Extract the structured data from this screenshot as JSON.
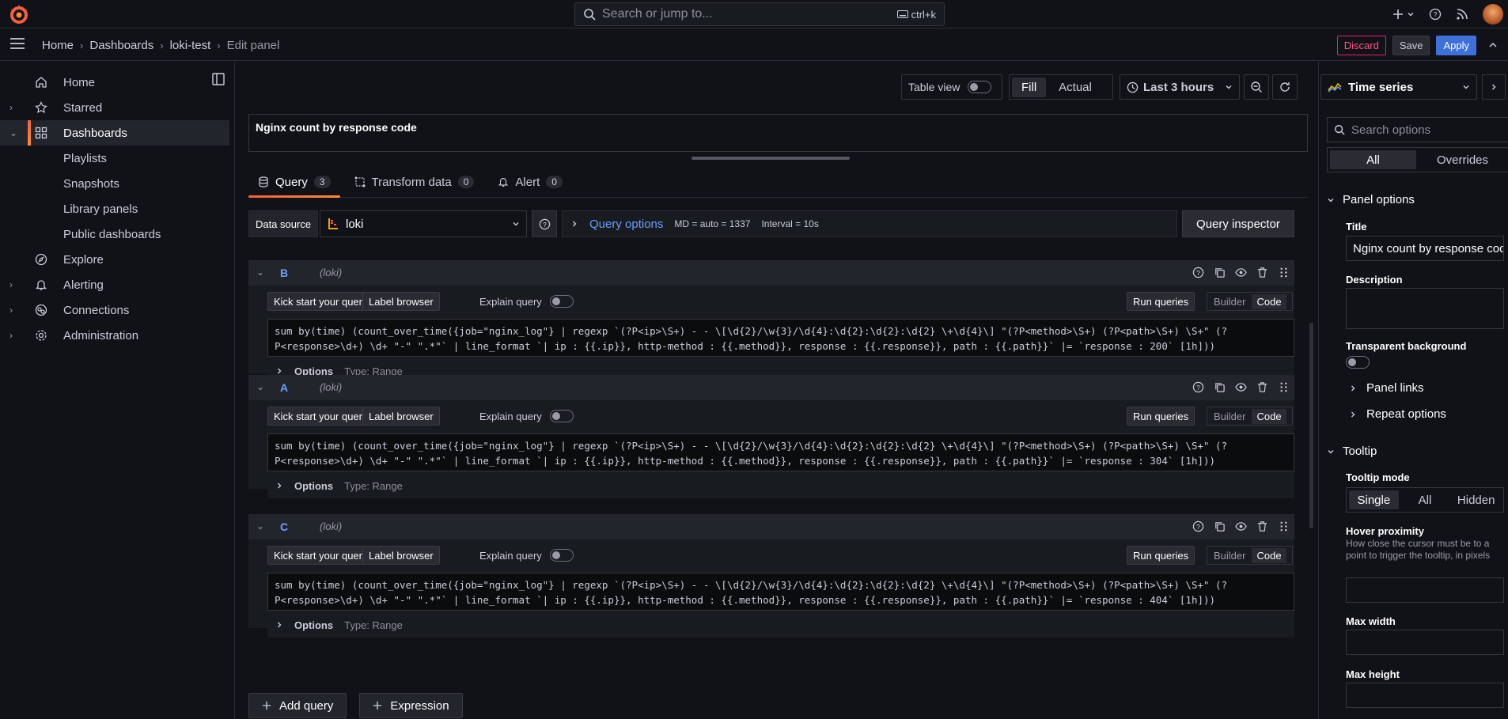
{
  "topbar": {
    "search_placeholder": "Search or jump to...",
    "shortcut": "ctrl+k"
  },
  "breadcrumb": {
    "items": [
      "Home",
      "Dashboards",
      "loki-test",
      "Edit panel"
    ]
  },
  "actions": {
    "discard": "Discard",
    "save": "Save",
    "apply": "Apply"
  },
  "sidebar": {
    "items": [
      {
        "label": "Home",
        "icon": "home-icon"
      },
      {
        "label": "Starred",
        "icon": "star-icon"
      },
      {
        "label": "Dashboards",
        "icon": "dashboards-icon"
      },
      {
        "label": "Playlists"
      },
      {
        "label": "Snapshots"
      },
      {
        "label": "Library panels"
      },
      {
        "label": "Public dashboards"
      },
      {
        "label": "Explore",
        "icon": "compass-icon"
      },
      {
        "label": "Alerting",
        "icon": "bell-icon"
      },
      {
        "label": "Connections",
        "icon": "connections-icon"
      },
      {
        "label": "Administration",
        "icon": "gear-icon"
      }
    ]
  },
  "toolbar": {
    "table_view": "Table view",
    "fill": "Fill",
    "actual": "Actual",
    "time_range": "Last 3 hours"
  },
  "panel": {
    "title": "Nginx count by response code"
  },
  "tabs": [
    {
      "label": "Query",
      "count": "3"
    },
    {
      "label": "Transform data",
      "count": "0"
    },
    {
      "label": "Alert",
      "count": "0"
    }
  ],
  "datasource": {
    "label": "Data source",
    "value": "loki",
    "query_options": "Query options",
    "md": "MD = auto = 1337",
    "interval": "Interval = 10s",
    "inspector": "Query inspector"
  },
  "query_ui": {
    "kick_start": "Kick start your query",
    "label_browser": "Label browser",
    "explain": "Explain query",
    "run": "Run queries",
    "builder": "Builder",
    "code": "Code",
    "options": "Options",
    "type": "Type: Range",
    "source": "(loki)"
  },
  "queries": [
    {
      "id": "B",
      "code_line1": "sum by(time) (count_over_time({job=\"nginx_log\"} | regexp `(?P<ip>\\S+) - - \\[\\d{2}/\\w{3}/\\d{4}:\\d{2}:\\d{2}:\\d{2} \\+\\d{4}\\] \"(?P<method>\\S+) (?P<path>\\S+) \\S+\" (?",
      "code_line2": "P<response>\\d+) \\d+ \"-\" \".*\"` | line_format `| ip : {{.ip}}, http-method : {{.method}}, response : {{.response}}, path : {{.path}}` |= `response : 200` [1h]))"
    },
    {
      "id": "A",
      "code_line1": "sum by(time) (count_over_time({job=\"nginx_log\"} | regexp `(?P<ip>\\S+) - - \\[\\d{2}/\\w{3}/\\d{4}:\\d{2}:\\d{2}:\\d{2} \\+\\d{4}\\] \"(?P<method>\\S+) (?P<path>\\S+) \\S+\" (?",
      "code_line2": "P<response>\\d+) \\d+ \"-\" \".*\"` | line_format `| ip : {{.ip}}, http-method : {{.method}}, response : {{.response}}, path : {{.path}}` |= `response : 304` [1h]))"
    },
    {
      "id": "C",
      "code_line1": "sum by(time) (count_over_time({job=\"nginx_log\"} | regexp `(?P<ip>\\S+) - - \\[\\d{2}/\\w{3}/\\d{4}:\\d{2}:\\d{2}:\\d{2} \\+\\d{4}\\] \"(?P<method>\\S+) (?P<path>\\S+) \\S+\" (?",
      "code_line2": "P<response>\\d+) \\d+ \"-\" \".*\"` | line_format `| ip : {{.ip}}, http-method : {{.method}}, response : {{.response}}, path : {{.path}}` |= `response : 404` [1h]))"
    }
  ],
  "add": {
    "query": "Add query",
    "expression": "Expression"
  },
  "options_pane": {
    "viz": "Time series",
    "search_placeholder": "Search options",
    "all": "All",
    "overrides": "Overrides",
    "panel_options": "Panel options",
    "title_label": "Title",
    "title_value": "Nginx count by response code",
    "description": "Description",
    "transparent": "Transparent background",
    "panel_links": "Panel links",
    "repeat_options": "Repeat options",
    "tooltip": "Tooltip",
    "tooltip_mode": "Tooltip mode",
    "single": "Single",
    "all_mode": "All",
    "hidden": "Hidden",
    "hover_proximity": "Hover proximity",
    "hover_help": "How close the cursor must be to a point to trigger the tooltip, in pixels",
    "max_width": "Max width",
    "max_height": "Max height"
  },
  "colors": {
    "accent": "#3d71d9",
    "brand": "#f55f3e",
    "discard": "#e0226e"
  }
}
